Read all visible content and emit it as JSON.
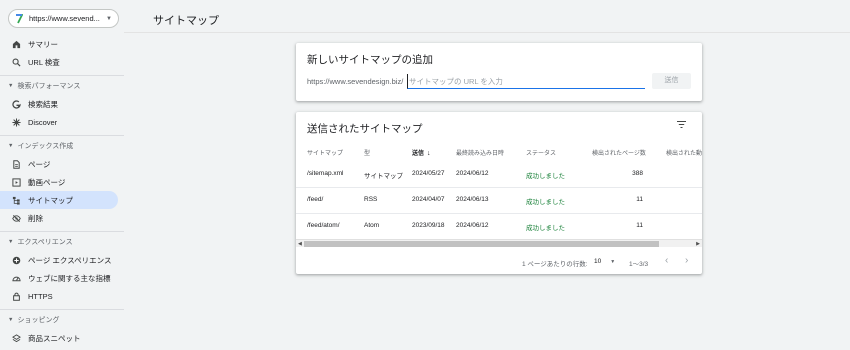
{
  "property": {
    "url": "https://www.sevend...",
    "logo_color": "#34a853"
  },
  "sidebar": {
    "items_top": [
      {
        "label": "サマリー",
        "icon": "home-icon"
      },
      {
        "label": "URL 検査",
        "icon": "search-icon"
      }
    ],
    "sections": [
      {
        "title": "検索パフォーマンス",
        "items": [
          {
            "label": "検索結果",
            "icon": "google-g-icon"
          },
          {
            "label": "Discover",
            "icon": "asterisk-icon"
          }
        ]
      },
      {
        "title": "インデックス作成",
        "items": [
          {
            "label": "ページ",
            "icon": "page-icon"
          },
          {
            "label": "動画ページ",
            "icon": "video-page-icon"
          },
          {
            "label": "サイトマップ",
            "icon": "sitemap-icon",
            "active": true
          },
          {
            "label": "削除",
            "icon": "eye-off-icon"
          }
        ]
      },
      {
        "title": "エクスペリエンス",
        "items": [
          {
            "label": "ページ エクスペリエンス",
            "icon": "plus-circle-icon"
          },
          {
            "label": "ウェブに関する主な指標",
            "icon": "speed-icon"
          },
          {
            "label": "HTTPS",
            "icon": "lock-icon"
          }
        ]
      },
      {
        "title": "ショッピング",
        "items": [
          {
            "label": "商品スニペット",
            "icon": "layers-icon"
          }
        ]
      }
    ]
  },
  "page": {
    "title": "サイトマップ"
  },
  "add_card": {
    "title": "新しいサイトマップの追加",
    "url_prefix": "https://www.sevendesign.biz/",
    "input_placeholder": "サイトマップの URL を入力",
    "input_value": "",
    "submit_label": "送信"
  },
  "submitted_card": {
    "title": "送信されたサイトマップ",
    "filter_icon": "filter-icon",
    "columns": [
      "サイトマップ",
      "型",
      "送信",
      "最終読み込み日時",
      "ステータス",
      "検出されたページ数",
      "検出された動"
    ],
    "sorted_column": "送信",
    "rows": [
      {
        "sitemap": "/sitemap.xml",
        "type": "サイトマップ",
        "submitted": "2024/05/27",
        "last_read": "2024/06/12",
        "status": "成功しました",
        "pages": "388"
      },
      {
        "sitemap": "/feed/",
        "type": "RSS",
        "submitted": "2024/04/07",
        "last_read": "2024/06/13",
        "status": "成功しました",
        "pages": "11"
      },
      {
        "sitemap": "/feed/atom/",
        "type": "Atom",
        "submitted": "2023/09/18",
        "last_read": "2024/06/12",
        "status": "成功しました",
        "pages": "11"
      }
    ],
    "pager": {
      "rows_per_page_label": "1 ページあたりの行数:",
      "rows_per_page": "10",
      "range": "1〜3/3"
    }
  },
  "colors": {
    "accent": "#1a73e8",
    "success": "#188038",
    "active_nav": "#d3e3fd"
  }
}
